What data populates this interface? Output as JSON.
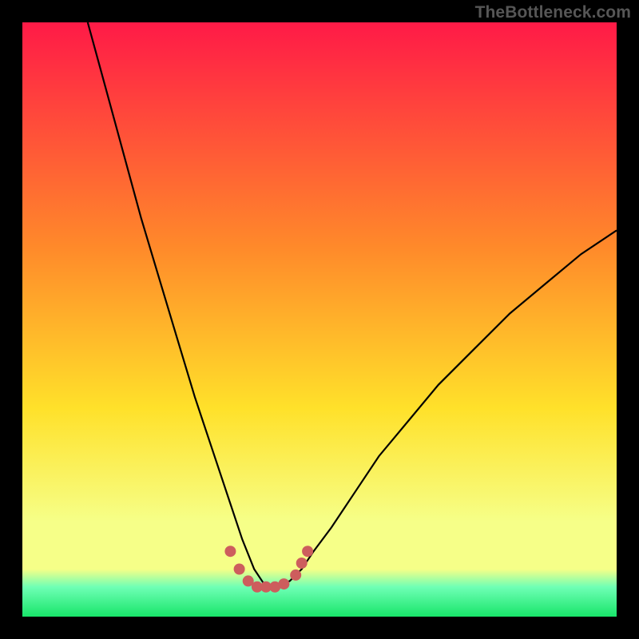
{
  "watermark": "TheBottleneck.com",
  "colors": {
    "top": "#ff1a47",
    "mid_upper": "#ff8a2a",
    "mid": "#ffe12a",
    "mid_lower": "#f6ff88",
    "aqua": "#6fffb5",
    "green": "#18e56a",
    "curve": "#000000",
    "dots": "#cd5d5d",
    "frame": "#000000"
  },
  "chart_data": {
    "type": "line",
    "title": "",
    "xlabel": "",
    "ylabel": "",
    "xlim": [
      0,
      100
    ],
    "ylim": [
      0,
      100
    ],
    "notes": "V-shaped bottleneck curve with minimum around x≈41; y-values estimated from plot pixels on 0–100 scale; markers are a small cluster near the minimum",
    "series": [
      {
        "name": "bottleneck-curve",
        "x": [
          11,
          14,
          17,
          20,
          23,
          26,
          29,
          32,
          35,
          37,
          39,
          41,
          43,
          45,
          47,
          49,
          52,
          56,
          60,
          65,
          70,
          76,
          82,
          88,
          94,
          100
        ],
        "y": [
          100,
          89,
          78,
          67,
          57,
          47,
          37,
          28,
          19,
          13,
          8,
          5,
          5,
          6,
          8,
          11,
          15,
          21,
          27,
          33,
          39,
          45,
          51,
          56,
          61,
          65
        ]
      }
    ],
    "markers": {
      "name": "highlight-dots",
      "x": [
        35,
        36.5,
        38,
        39.5,
        41,
        42.5,
        44,
        46,
        47,
        48
      ],
      "y": [
        11,
        8,
        6,
        5,
        5,
        5,
        5.5,
        7,
        9,
        11
      ]
    }
  }
}
